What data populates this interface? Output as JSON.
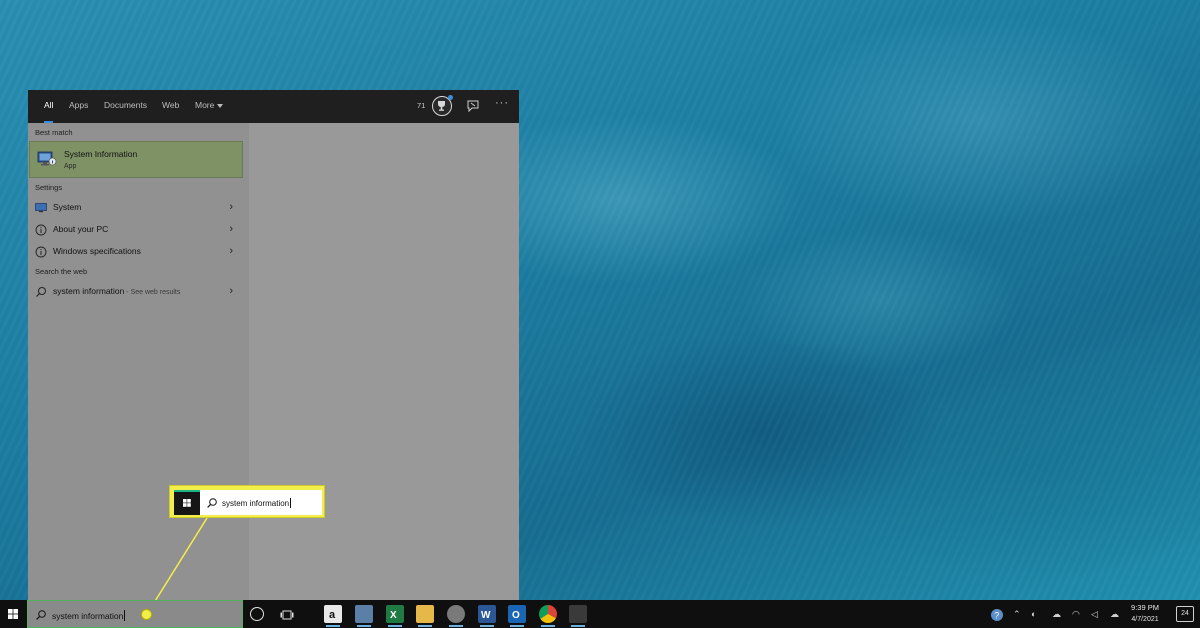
{
  "search_panel": {
    "tabs": [
      {
        "label": "All",
        "active": true
      },
      {
        "label": "Apps",
        "active": false
      },
      {
        "label": "Documents",
        "active": false
      },
      {
        "label": "Web",
        "active": false
      },
      {
        "label": "More",
        "active": false
      }
    ],
    "rewards_points": "71",
    "more_options": "···",
    "best_match": {
      "section_label": "Best match",
      "title": "System Information",
      "subtitle": "App"
    },
    "settings": {
      "section_label": "Settings",
      "items": [
        {
          "label": "System",
          "icon": "monitor-icon"
        },
        {
          "label": "About your PC",
          "icon": "info-icon"
        },
        {
          "label": "Windows specifications",
          "icon": "info-icon"
        }
      ]
    },
    "web": {
      "section_label": "Search the web",
      "query": "system information",
      "hint": " - See web results"
    }
  },
  "callout": {
    "search_text": "system information",
    "highlight_color": "#f3ef4a"
  },
  "taskbar": {
    "search_text": "system information",
    "tray": {
      "time": "9:39 PM",
      "date": "4/7/2021",
      "notifications": "24"
    }
  },
  "colors": {
    "accent_blue": "#3a8dde",
    "best_match_bg": "#7f9266",
    "taskbar_bg": "#0f0f0f"
  }
}
